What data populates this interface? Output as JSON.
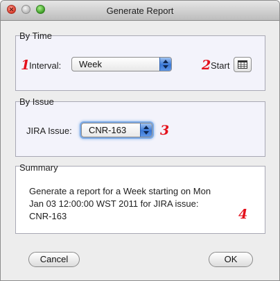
{
  "window": {
    "title": "Generate Report"
  },
  "by_time": {
    "group_label": "By Time",
    "interval_label": "Interval:",
    "interval_value": "Week",
    "start_label": "Start"
  },
  "by_issue": {
    "group_label": "By Issue",
    "issue_label": "JIRA Issue:",
    "issue_value": "CNR-163"
  },
  "summary": {
    "group_label": "Summary",
    "text": "Generate a report for a Week starting on Mon\nJan 03 12:00:00 WST 2011 for JIRA issue:\nCNR-163"
  },
  "buttons": {
    "cancel": "Cancel",
    "ok": "OK"
  },
  "markers": [
    "1",
    "2",
    "3",
    "4"
  ],
  "colors": {
    "marker": "#e4101b",
    "group_background": "#f3f3fb",
    "select_arrow_blue": "#3a78d6"
  },
  "icons": [
    "close-icon",
    "minimize-icon",
    "zoom-icon",
    "calendar-icon",
    "up-down-arrows-icon"
  ]
}
